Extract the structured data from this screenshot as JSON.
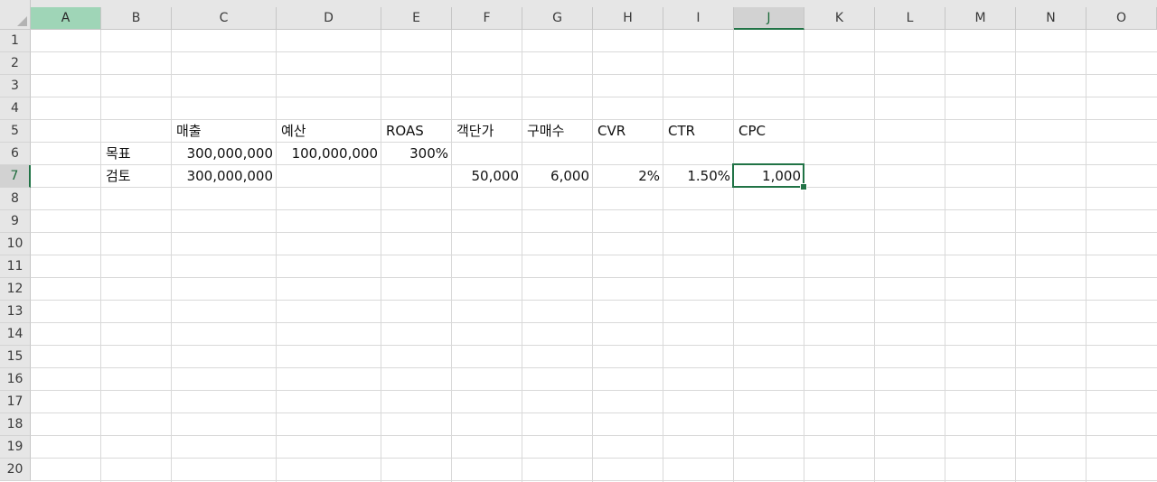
{
  "spreadsheet": {
    "columns": [
      "A",
      "B",
      "C",
      "D",
      "E",
      "F",
      "G",
      "H",
      "I",
      "J",
      "K",
      "L",
      "M",
      "N",
      "O"
    ],
    "rows": [
      "1",
      "2",
      "3",
      "4",
      "5",
      "6",
      "7",
      "8",
      "9",
      "10",
      "11",
      "12",
      "13",
      "14",
      "15",
      "16",
      "17",
      "18",
      "19",
      "20"
    ],
    "selected_column": "J",
    "selected_row": "7",
    "active_cell": "J7",
    "cells": {
      "C5": "매출",
      "D5": "예산",
      "E5": "ROAS",
      "F5": "객단가",
      "G5": "구매수",
      "H5": "CVR",
      "I5": "CTR",
      "J5": "CPC",
      "B6": "목표",
      "C6": "300,000,000",
      "D6": "100,000,000",
      "E6": "300%",
      "B7": "검토",
      "C7": "300,000,000",
      "F7": "50,000",
      "G7": "6,000",
      "H7": "2%",
      "I7": "1.50%",
      "J7": "1,000"
    },
    "colors": {
      "accent": "#217346",
      "header_bg": "#e6e6e6",
      "gridline": "#d9d9d9"
    }
  }
}
